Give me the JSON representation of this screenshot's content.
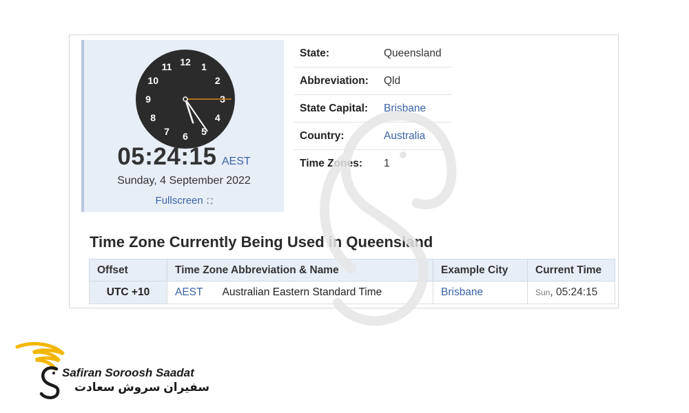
{
  "clock": {
    "time": "05:24:15",
    "timezone": "AEST",
    "date": "Sunday, 4 September 2022",
    "fullscreen_label": "Fullscreen",
    "numbers": [
      "12",
      "1",
      "2",
      "3",
      "4",
      "5",
      "6",
      "7",
      "8",
      "9",
      "10",
      "11"
    ],
    "hours": 5,
    "minutes": 24,
    "seconds": 15
  },
  "info": [
    {
      "label": "State:",
      "value": "Queensland",
      "link": false
    },
    {
      "label": "Abbreviation:",
      "value": "Qld",
      "link": false
    },
    {
      "label": "State Capital:",
      "value": "Brisbane",
      "link": true
    },
    {
      "label": "Country:",
      "value": "Australia",
      "link": true
    },
    {
      "label": "Time Zones:",
      "value": "1",
      "link": false
    }
  ],
  "section_title": "Time Zone Currently Being Used in Queensland",
  "tz_table": {
    "headers": [
      "Offset",
      "Time Zone Abbreviation & Name",
      "Example City",
      "Current Time"
    ],
    "row": {
      "offset": "UTC +10",
      "abbr": "AEST",
      "name": "Australian Eastern Standard Time",
      "city": "Brisbane",
      "day": "Sun",
      "time": ", 05:24:15"
    }
  },
  "logo": {
    "name_en": "Safiran Soroosh Saadat",
    "name_fa": "سفیران سروش سعادت"
  },
  "colors": {
    "link": "#3a63a8",
    "panel": "#e8eef6",
    "clock_face": "#2b2b2b",
    "second_hand": "#d98a1a",
    "logo_gold": "#f2b705"
  }
}
